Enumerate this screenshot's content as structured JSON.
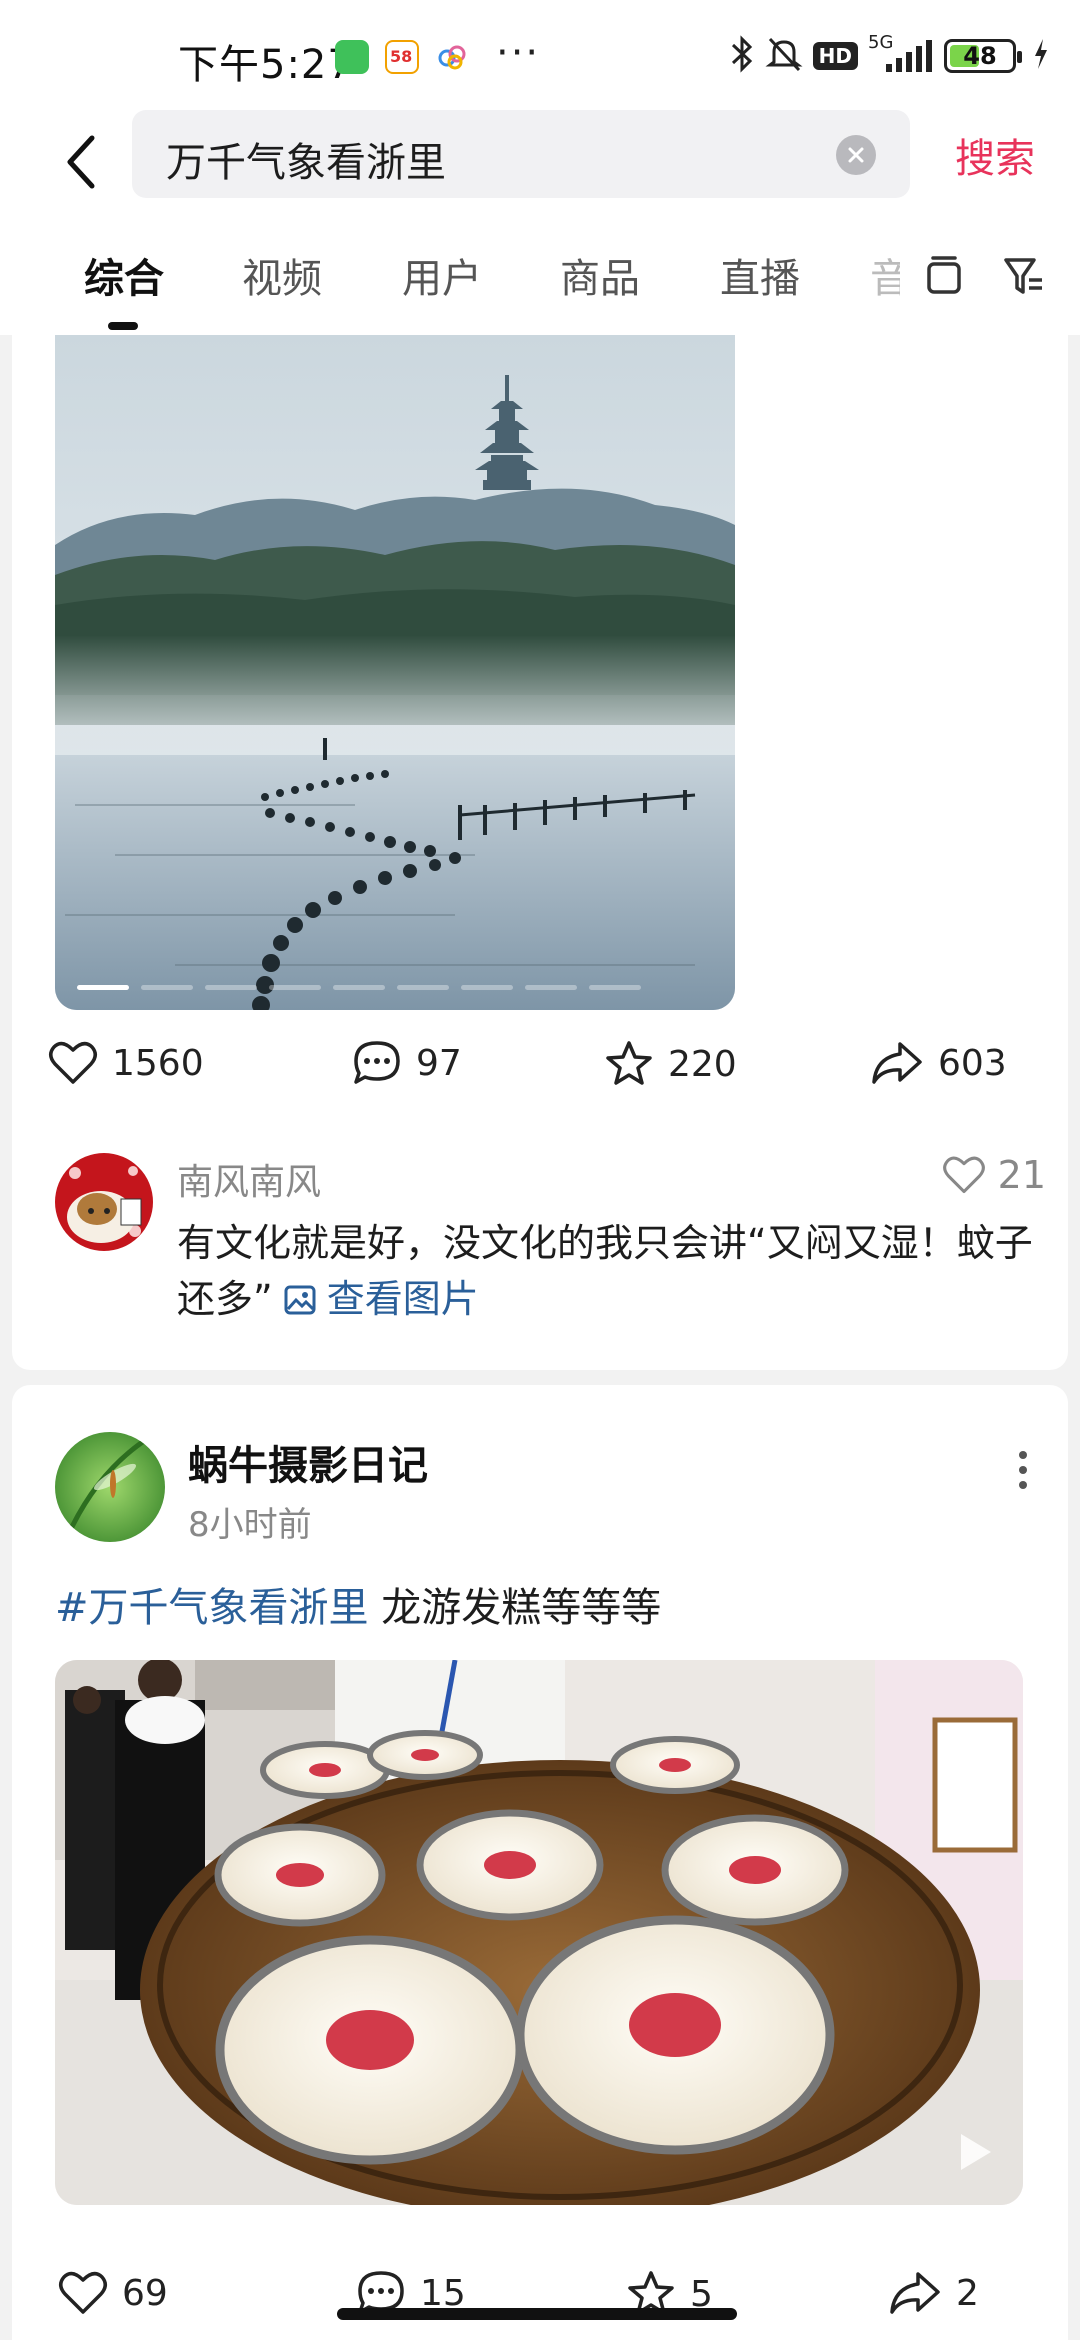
{
  "status_bar": {
    "time": "下午5:27",
    "app_icons": [
      "wechat-icon",
      "58-app-icon",
      "cloud-app-icon"
    ],
    "more": "···",
    "network": "5G",
    "hd": "HD",
    "battery": "48",
    "battery_level": 0.48
  },
  "search": {
    "query": "万千气象看浙里",
    "button": "搜索"
  },
  "tabs": [
    {
      "label": "综合",
      "active": true
    },
    {
      "label": "视频"
    },
    {
      "label": "用户"
    },
    {
      "label": "商品"
    },
    {
      "label": "直播"
    },
    {
      "label": "音"
    }
  ],
  "post1": {
    "stats": {
      "likes": "1560",
      "comments": "97",
      "favorites": "220",
      "shares": "603"
    },
    "image_count": 9,
    "active_image": 1,
    "comment": {
      "user": "南风南风",
      "likes": "21",
      "text": " 有文化就是好，没文化的我只会讲“又闷又湿！蚊子还多”",
      "view_image": "查看图片"
    }
  },
  "post2": {
    "author": "蜗牛摄影日记",
    "time": "8小时前",
    "hashtag": "#万千气象看浙里",
    "text": " 龙游发糕等等等",
    "stats": {
      "likes": "69",
      "comments": "15",
      "favorites": "5",
      "shares": "2"
    }
  },
  "colors": {
    "accent": "#e8335b",
    "link": "#2a5f99"
  }
}
